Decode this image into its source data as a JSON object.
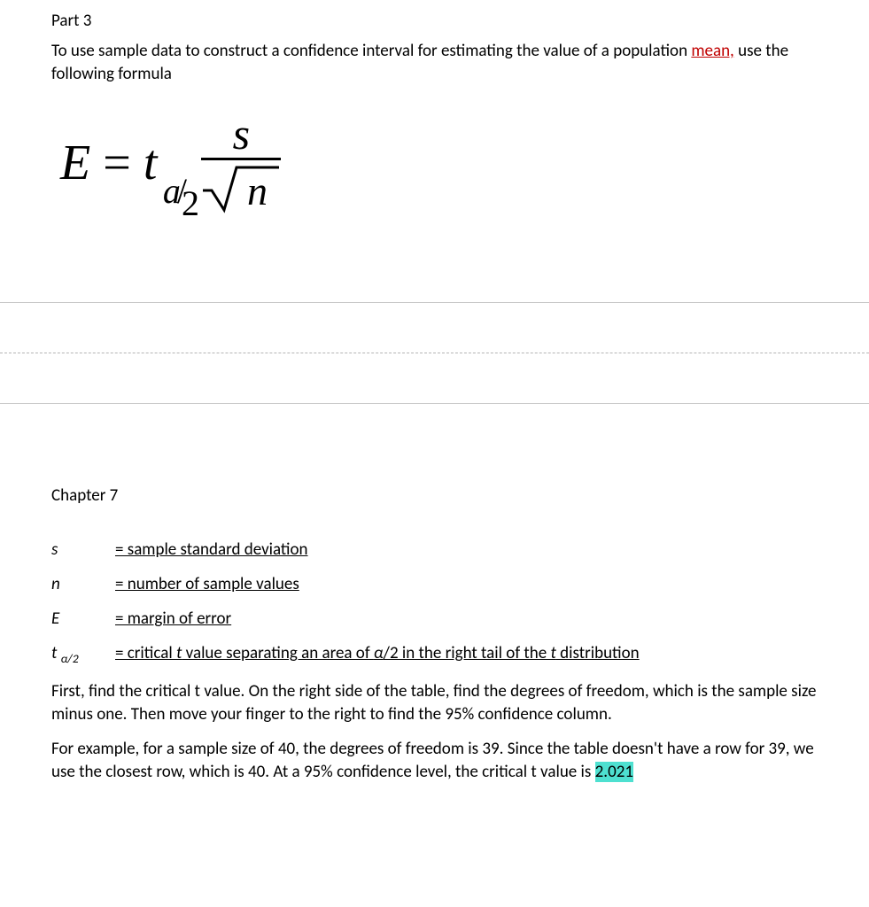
{
  "part_label": "Part 3",
  "intro_pre": "To use sample data to construct a confidence interval for estimating the value of a population ",
  "intro_link": "mean,",
  "intro_post": " use the following formula",
  "formula": {
    "E": "E",
    "eq": "=",
    "t": "t",
    "a": "a",
    "two": "2",
    "s": "s",
    "n": "n"
  },
  "chapter": "Chapter 7",
  "defs": {
    "s_sym": "s",
    "s_def": "= sample standard deviation",
    "n_sym": "n",
    "n_def": "= number of sample values",
    "E_sym": "E",
    "E_def": "= margin of error",
    "t_sym_base": "t ",
    "t_sym_sub": "α/2",
    "t_def_pre": "= critical ",
    "t_def_it1": "t",
    "t_def_mid": " value separating an area of ",
    "t_def_it2": "α",
    "t_def_mid2": "/2 in the right tail of the ",
    "t_def_it3": "t",
    "t_def_post": " distribution"
  },
  "para1": "First, find the critical t value. On the right side of the table, find the degrees of freedom, which is the sample size minus one. Then move your finger to the right to find the 95% confidence column.",
  "para2_pre": "For example, for a sample size of 40, the degrees of freedom is 39. Since the table doesn't have a row for 39, we use the closest row, which is 40. At a 95% confidence level, the critical t value is ",
  "para2_hl": "2.021"
}
